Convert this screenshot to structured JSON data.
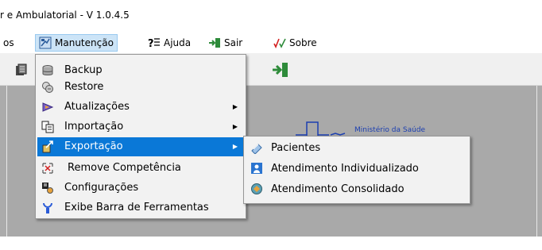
{
  "window": {
    "title": "r e Ambulatorial - V 1.0.4.5"
  },
  "menubar": {
    "items": [
      {
        "label": "os",
        "icon": ""
      },
      {
        "label": "Manutenção",
        "icon": "maintenance-icon"
      },
      {
        "label": "Ajuda",
        "icon": "help-icon"
      },
      {
        "label": "Sair",
        "icon": "exit-icon"
      },
      {
        "label": "Sobre",
        "icon": "about-checkmarks-icon"
      }
    ]
  },
  "logo": {
    "text": "Ministério da Saúde"
  },
  "dropdown": {
    "items": [
      {
        "label": "Backup",
        "icon": "database-icon",
        "submenu": false
      },
      {
        "label": "Restore",
        "icon": "restore-icon",
        "submenu": false
      },
      {
        "label": "Atualizações",
        "icon": "updates-icon",
        "submenu": true
      },
      {
        "label": "Importação",
        "icon": "import-icon",
        "submenu": true
      },
      {
        "label": "Exportação",
        "icon": "export-icon",
        "submenu": true
      },
      {
        "label": "Remove Competência",
        "icon": "remove-icon",
        "submenu": false
      },
      {
        "label": "Configurações",
        "icon": "settings-icon",
        "submenu": false
      },
      {
        "label": "Exibe Barra de Ferramentas",
        "icon": "toolbar-icon",
        "submenu": false
      }
    ]
  },
  "submenu": {
    "items": [
      {
        "label": "Pacientes",
        "icon": "patients-icon"
      },
      {
        "label": "Atendimento Individualizado",
        "icon": "individual-care-icon"
      },
      {
        "label": "Atendimento Consolidado",
        "icon": "consolidated-care-icon"
      }
    ]
  },
  "colors": {
    "highlight": "#0a78d7",
    "menu_bg": "#f2f2f2",
    "client_bg": "#ababab",
    "active_top_menu": "#cce4f7"
  }
}
